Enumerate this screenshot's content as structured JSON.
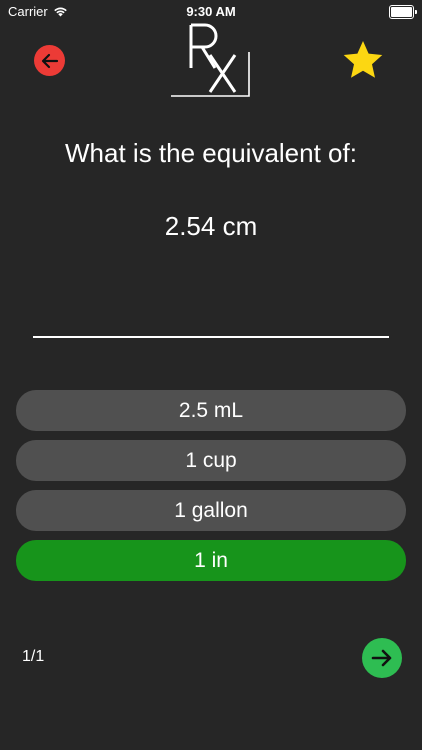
{
  "status_bar": {
    "carrier": "Carrier",
    "time": "9:30 AM"
  },
  "header": {
    "back_icon": "arrow-left-icon",
    "logo_text": "Rx",
    "favorite_icon": "star-icon"
  },
  "question": {
    "prompt": "What is the equivalent of:",
    "value": "2.54 cm"
  },
  "options": [
    {
      "label": "2.5 mL",
      "selected": false
    },
    {
      "label": "1 cup",
      "selected": false
    },
    {
      "label": "1 gallon",
      "selected": false
    },
    {
      "label": "1 in",
      "selected": true
    }
  ],
  "footer": {
    "counter": "1/1",
    "next_icon": "arrow-right-icon"
  },
  "colors": {
    "background": "#262626",
    "back_button": "#ec3b36",
    "star": "#fcd712",
    "option": "#505050",
    "selected_option": "#17941b",
    "next_button": "#2ebd52"
  }
}
